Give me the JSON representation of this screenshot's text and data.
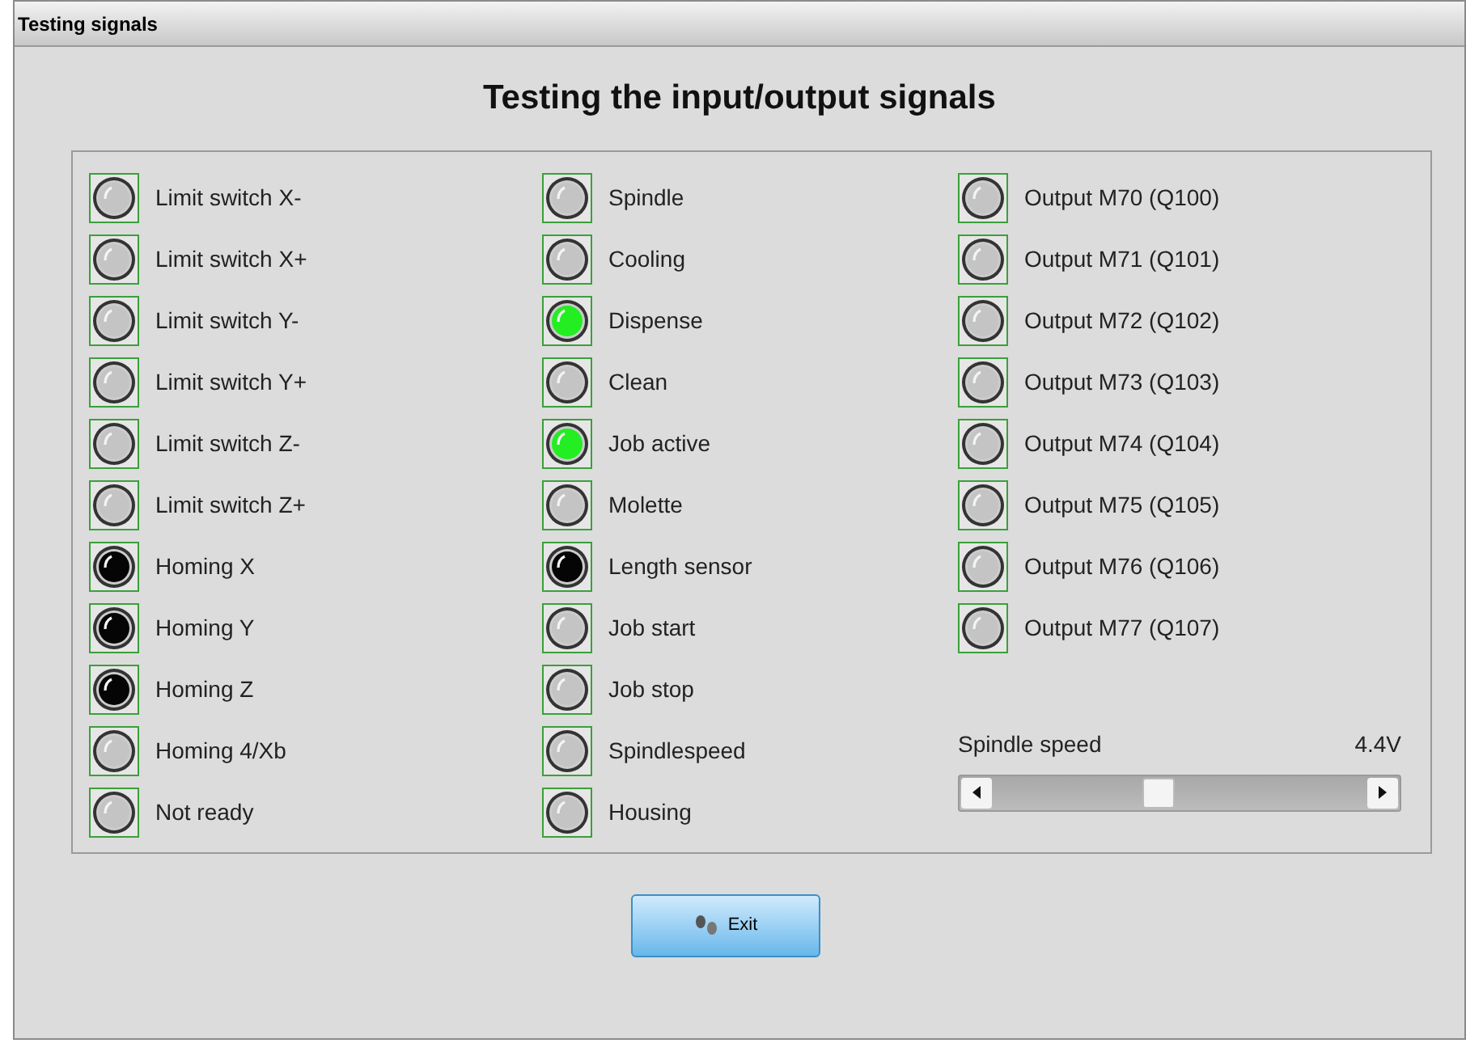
{
  "window": {
    "title": "Testing signals"
  },
  "heading": "Testing the input/output signals",
  "columns": [
    [
      {
        "label": "Limit switch X-",
        "color": "#c4c4c4"
      },
      {
        "label": "Limit switch X+",
        "color": "#c4c4c4"
      },
      {
        "label": "Limit switch Y-",
        "color": "#c4c4c4"
      },
      {
        "label": "Limit switch Y+",
        "color": "#c4c4c4"
      },
      {
        "label": "Limit switch Z-",
        "color": "#c4c4c4"
      },
      {
        "label": "Limit switch Z+",
        "color": "#c4c4c4"
      },
      {
        "label": "Homing X",
        "color": "#050505"
      },
      {
        "label": "Homing Y",
        "color": "#050505"
      },
      {
        "label": "Homing Z",
        "color": "#050505"
      },
      {
        "label": "Homing 4/Xb",
        "color": "#c4c4c4"
      },
      {
        "label": "Not ready",
        "color": "#c4c4c4"
      }
    ],
    [
      {
        "label": "Spindle",
        "color": "#c4c4c4"
      },
      {
        "label": "Cooling",
        "color": "#c4c4c4"
      },
      {
        "label": "Dispense",
        "color": "#22ee22"
      },
      {
        "label": "Clean",
        "color": "#c4c4c4"
      },
      {
        "label": "Job active",
        "color": "#22ee22"
      },
      {
        "label": "Molette",
        "color": "#c4c4c4"
      },
      {
        "label": "Length sensor",
        "color": "#050505"
      },
      {
        "label": "Job start",
        "color": "#c4c4c4"
      },
      {
        "label": "Job stop",
        "color": "#c4c4c4"
      },
      {
        "label": "Spindlespeed",
        "color": "#c4c4c4"
      },
      {
        "label": "Housing",
        "color": "#c4c4c4"
      }
    ],
    [
      {
        "label": "Output M70 (Q100)",
        "color": "#c4c4c4"
      },
      {
        "label": "Output M71 (Q101)",
        "color": "#c4c4c4"
      },
      {
        "label": "Output M72 (Q102)",
        "color": "#c4c4c4"
      },
      {
        "label": "Output M73 (Q103)",
        "color": "#c4c4c4"
      },
      {
        "label": "Output M74 (Q104)",
        "color": "#c4c4c4"
      },
      {
        "label": "Output M75 (Q105)",
        "color": "#c4c4c4"
      },
      {
        "label": "Output M76 (Q106)",
        "color": "#c4c4c4"
      },
      {
        "label": "Output M77 (Q107)",
        "color": "#c4c4c4"
      }
    ]
  ],
  "slider": {
    "label": "Spindle speed",
    "reading": "4.4V",
    "level": 0.44
  },
  "exit_button": {
    "label": "Exit"
  }
}
